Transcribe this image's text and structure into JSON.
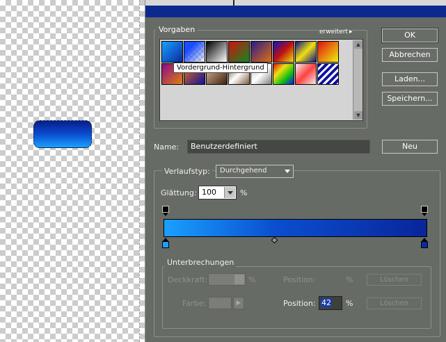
{
  "canvas": {
    "shape_gradient": [
      "#0a1e8a",
      "#1aa0ff"
    ]
  },
  "dialog": {
    "presets": {
      "legend": "Vorgaben",
      "more": "erweitert",
      "tooltip": "Vordergrund-Hintergrund",
      "swatches_row1": [
        "linear-gradient(135deg,#1aa0ff,#0a2aa0)",
        "linear-gradient(135deg,#1a4cff 0%,#1a4cff 30%,transparent 100%)",
        "linear-gradient(135deg,#000,#fff)",
        "linear-gradient(135deg,#d01010,#108a20)",
        "linear-gradient(135deg,#2a1a8a,#e07010)",
        "linear-gradient(135deg,#1010c0,#c01010,#f0e010)",
        "linear-gradient(135deg,#101090,#f0e010,#101090)",
        "linear-gradient(135deg,#e01010,#f0f010)"
      ],
      "swatches_row2": [
        "linear-gradient(135deg,#8a0a8a,#e08010)",
        "linear-gradient(135deg,#f07010,#1010a0)",
        "linear-gradient(135deg,#e0c0a0,#402010)",
        "linear-gradient(135deg,#604020,#ffffff,#806040)",
        "linear-gradient(135deg,#c0c0c0,#fff,#808080)",
        "linear-gradient(135deg,#e01010,#f0e010,#10c010,#1010f0)",
        "linear-gradient(135deg,#f0f0f0,#ff4040,#f0f0f0)",
        "repeating-linear-gradient(135deg,#1010a0 0 4px,#ffffff 4px 7px)"
      ]
    },
    "buttons": {
      "ok": "OK",
      "cancel": "Abbrechen",
      "load": "Laden...",
      "save": "Speichern...",
      "new": "Neu"
    },
    "name": {
      "label": "Name:",
      "value": "Benutzerdefiniert"
    },
    "gradient_type": {
      "label": "Verlaufstyp:",
      "value": "Durchgehend"
    },
    "smoothness": {
      "label": "Glättung:",
      "value": "100",
      "unit": "%"
    },
    "gradient": {
      "colors": [
        "#1aa0ff",
        "#0a4fd0",
        "#09259a"
      ],
      "left_stop_color": "#1aa0ff",
      "right_stop_color": "#0a2aa0"
    },
    "stops": {
      "legend": "Unterbrechungen",
      "opacity_label": "Deckkraft:",
      "opacity_unit": "%",
      "opacity_position_label": "Position:",
      "opacity_position_unit": "%",
      "delete_label_1": "Löschen",
      "color_label": "Farbe:",
      "color_position_label": "Position:",
      "color_position_value": "42",
      "color_position_unit": "%",
      "delete_label_2": "Löschen"
    }
  }
}
